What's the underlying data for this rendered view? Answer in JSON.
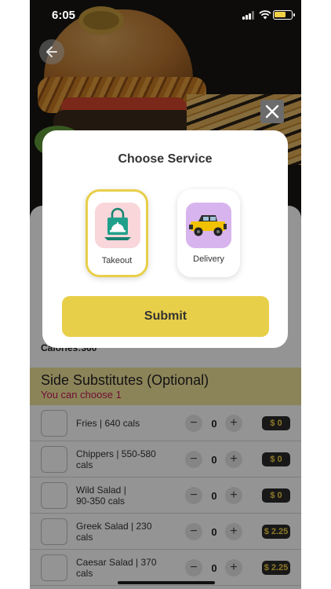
{
  "status_bar": {
    "time": "6:05"
  },
  "modal": {
    "title": "Choose Service",
    "options": [
      {
        "label": "Takeout",
        "selected": true,
        "icon": "takeout-bag-icon",
        "icon_bg": "#f9d6da"
      },
      {
        "label": "Delivery",
        "selected": false,
        "icon": "jeep-icon",
        "icon_bg": "#d8b4ee"
      }
    ],
    "submit_label": "Submit"
  },
  "background": {
    "calories_text": "Calories:360",
    "section": {
      "title": "Side Substitutes  (Optional)",
      "subtitle": "You can choose 1"
    },
    "items": [
      {
        "label": "Fries | 640 cals",
        "qty": "0",
        "price": "$ 0"
      },
      {
        "label": "Chippers | 550-580 cals",
        "qty": "0",
        "price": "$ 0"
      },
      {
        "label": "Wild Salad | 90-350 cals",
        "qty": "0",
        "price": "$ 0"
      },
      {
        "label": "Greek Salad | 230 cals",
        "qty": "0",
        "price": "$ 2.25"
      },
      {
        "label": "Caesar Salad | 370 cals",
        "qty": "0",
        "price": "$ 2.25"
      }
    ]
  },
  "colors": {
    "accent": "#e8cf49",
    "price_text": "#f2d046",
    "subtitle": "#c2185b",
    "section_bg": "#f1e39a"
  }
}
